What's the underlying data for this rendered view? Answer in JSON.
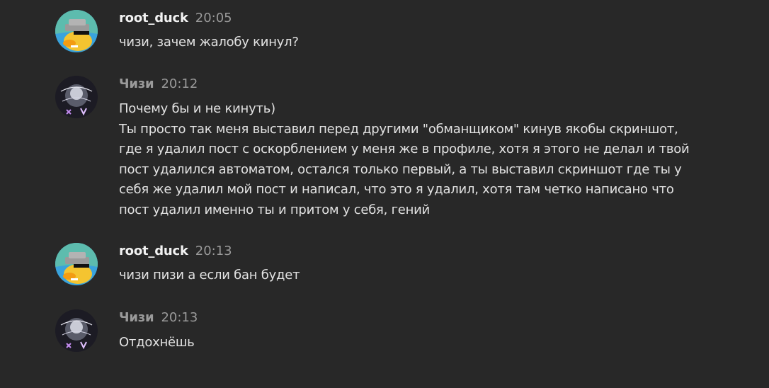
{
  "messages": [
    {
      "author": "root_duck",
      "time": "20:05",
      "author_color": "#f2f2f2",
      "avatar_icon": "duck-with-hat-avatar",
      "lines": [
        "чизи, зачем жалобу кинул?"
      ]
    },
    {
      "author": "Чизи",
      "time": "20:12",
      "author_color": "#9a9a9a",
      "avatar_icon": "dark-anime-avatar",
      "lines": [
        "Почему бы и не кинуть)",
        "Ты просто так меня выставил перед другими \"обманщиком\" кинув якобы скриншот,",
        "где я удалил пост с оскорблением у меня же в профиле, хотя я этого не делал и твой",
        "пост удалился автоматом, остался только первый, а ты выставил скриншот где ты у",
        "себя же удалил мой пост и написал, что это я удалил, хотя там четко написано что",
        "пост удалил именно ты и притом у себя, гений"
      ]
    },
    {
      "author": "root_duck",
      "time": "20:13",
      "author_color": "#f2f2f2",
      "avatar_icon": "duck-with-hat-avatar",
      "lines": [
        "чизи пизи а если бан будет"
      ]
    },
    {
      "author": "Чизи",
      "time": "20:13",
      "author_color": "#9a9a9a",
      "avatar_icon": "dark-anime-avatar",
      "lines": [
        "Отдохнёшь"
      ]
    }
  ]
}
